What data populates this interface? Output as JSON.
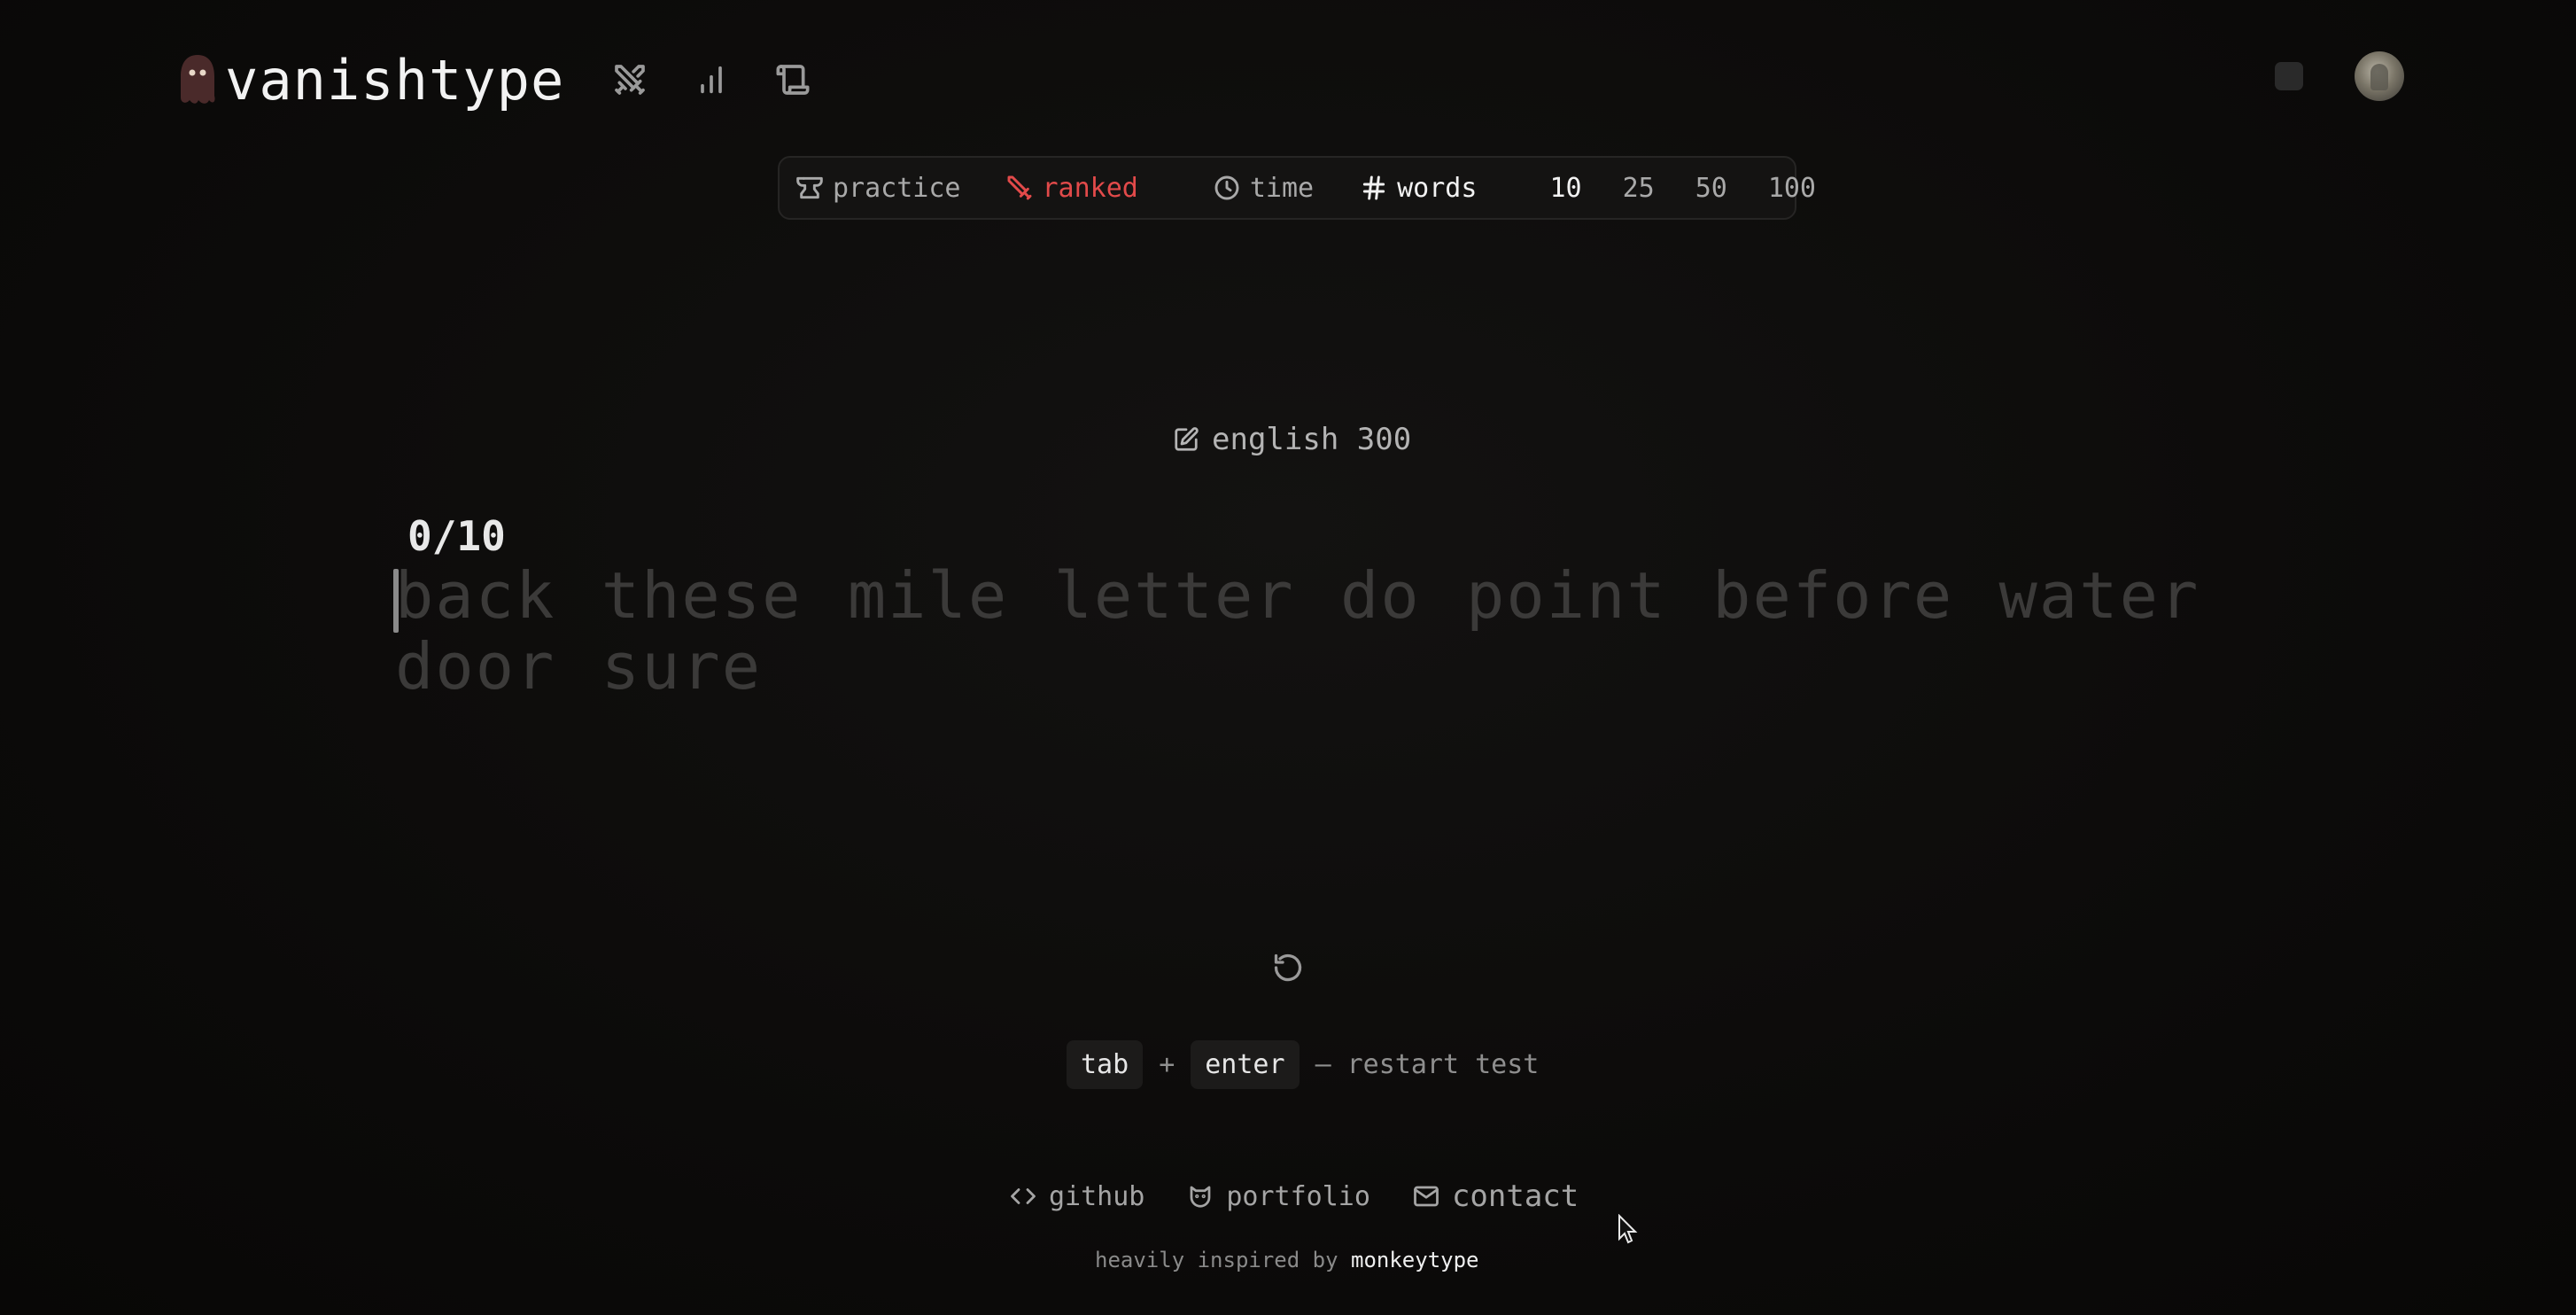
{
  "header": {
    "brand": "vanishtype",
    "nav_icons": [
      "swords-icon",
      "bar-chart-icon",
      "scroll-icon"
    ]
  },
  "modebar": {
    "practice": "practice",
    "ranked": "ranked",
    "time": "time",
    "words": "words",
    "counts": [
      "10",
      "25",
      "50",
      "100"
    ],
    "selected_count": "10",
    "ranked_color": "#e24a4a"
  },
  "language": "english 300",
  "test": {
    "counter": "0/10",
    "words": "back these mile letter do point before water door sure"
  },
  "hint": {
    "key1": "tab",
    "plus": "+",
    "key2": "enter",
    "dash": "–",
    "label": "restart test"
  },
  "footer": {
    "github": "github",
    "portfolio": "portfolio",
    "contact": "contact",
    "credit_prefix": "heavily inspired by",
    "credit_link": "monkeytype"
  }
}
